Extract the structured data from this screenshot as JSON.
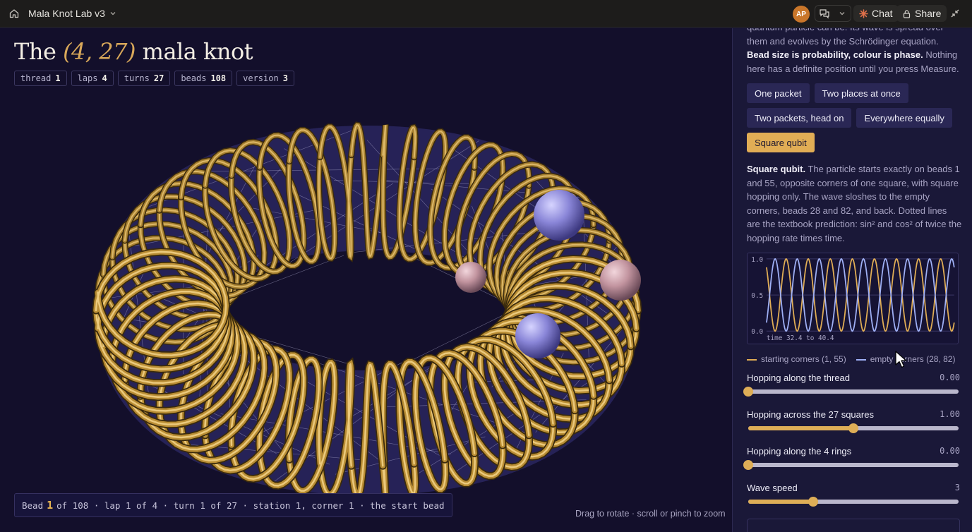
{
  "app": {
    "title": "Mala Knot Lab v3",
    "avatar_initials": "AP"
  },
  "topbar": {
    "chat_label": "Chat",
    "share_label": "Share"
  },
  "title": {
    "prefix": "The",
    "pair": "(4, 27)",
    "suffix": "mala knot"
  },
  "chips": [
    {
      "label": "thread",
      "value": "1"
    },
    {
      "label": "laps",
      "value": "4"
    },
    {
      "label": "turns",
      "value": "27"
    },
    {
      "label": "beads",
      "value": "108"
    },
    {
      "label": "version",
      "value": "3"
    }
  ],
  "bead_info": {
    "prefix": "Bead",
    "number": "1",
    "rest": "of 108 · lap 1 of 4 · turn 1 of 27 · station 1, corner 1 · the start bead"
  },
  "hint": "Drag to rotate · scroll or pinch to zoom",
  "panel": {
    "intro_text": "quantum particle can be. Its wave is spread over them and evolves by the Schrödinger equation.",
    "intro_bold": "Bead size is probability, colour is phase.",
    "intro_tail": "Nothing here has a definite position until you press Measure.",
    "presets": [
      "One packet",
      "Two places at once",
      "Two packets, head on",
      "Everywhere equally",
      "Square qubit"
    ],
    "active_preset": "Square qubit",
    "desc_bold": "Square qubit.",
    "desc_text": "The particle starts exactly on beads 1 and 55, opposite corners of one square, with square hopping only. The wave sloshes to the empty corners, beads 28 and 82, and back. Dotted lines are the textbook prediction: sin² and cos² of twice the hopping rate times time.",
    "legend": [
      "starting corners (1, 55)",
      "empty corners (28, 82)"
    ],
    "sliders": [
      {
        "label": "Hopping along the thread",
        "value": "0.00",
        "fraction": 0.0
      },
      {
        "label": "Hopping across the 27 squares",
        "value": "1.00",
        "fraction": 0.5
      },
      {
        "label": "Hopping along the 4 rings",
        "value": "0.00",
        "fraction": 0.0
      },
      {
        "label": "Wave speed",
        "value": "3",
        "fraction": 0.31
      }
    ]
  },
  "chart_data": {
    "type": "line",
    "x_range_label": "time 32.4 to 40.4",
    "x": [
      32.4,
      40.4
    ],
    "ylim": [
      0.0,
      1.0
    ],
    "yticks": [
      "1.0",
      "0.5",
      "0.0"
    ],
    "grid": true,
    "series": [
      {
        "name": "starting corners (1, 55)",
        "color": "#e0ad55",
        "oscillations": 8.5
      },
      {
        "name": "empty corners (28, 82)",
        "color": "#9fb0f5",
        "oscillations": 8.5
      }
    ]
  },
  "colors": {
    "accent": "#e1ad55",
    "blue": "#9fb0f5",
    "panel_bg": "#1a1838",
    "scene_bg": "#130f2b"
  }
}
